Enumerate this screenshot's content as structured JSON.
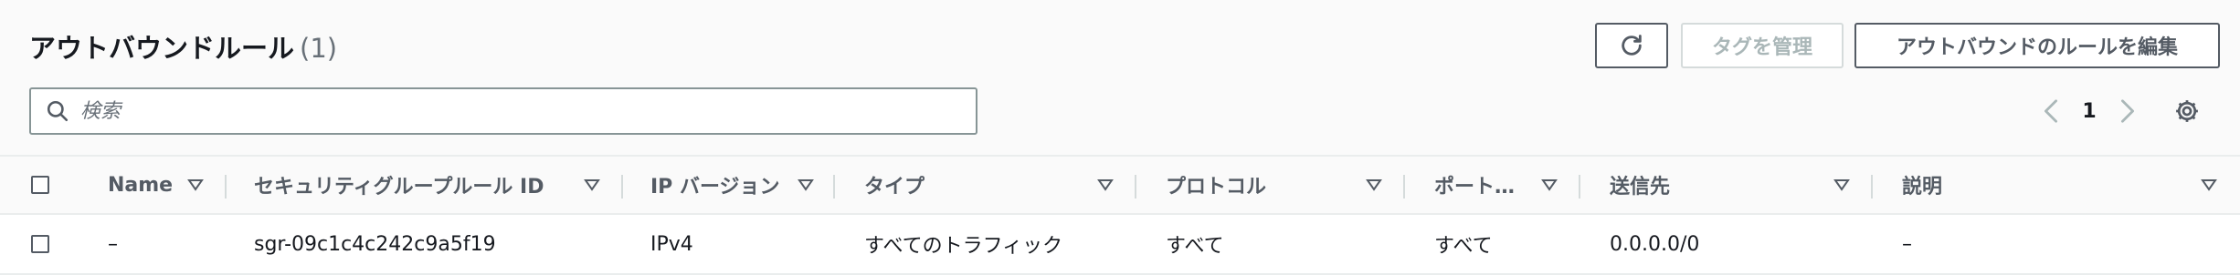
{
  "header": {
    "title": "アウトバウンドルール",
    "count": "(1)",
    "buttons": {
      "refresh_icon": "refresh-icon",
      "manage_tags": "タグを管理",
      "edit_outbound_rules": "アウトバウンドのルールを編集"
    }
  },
  "search": {
    "placeholder": "検索",
    "value": ""
  },
  "pagination": {
    "current_page": "1",
    "prev_icon": "chevron-left-icon",
    "next_icon": "chevron-right-icon",
    "settings_icon": "gear-icon"
  },
  "table": {
    "columns": [
      "Name",
      "セキュリティグループルール ID",
      "IP バージョン",
      "タイプ",
      "プロトコル",
      "ポート…",
      "送信先",
      "説明"
    ],
    "rows": [
      [
        "–",
        "sgr-09c1c4c242c9a5f19",
        "IPv4",
        "すべてのトラフィック",
        "すべて",
        "すべて",
        "0.0.0.0/0",
        "–"
      ]
    ]
  },
  "colors": {
    "text_primary": "#16191f",
    "text_secondary": "#545b64",
    "muted": "#687078",
    "disabled": "#aab7b8",
    "border": "#879596"
  }
}
